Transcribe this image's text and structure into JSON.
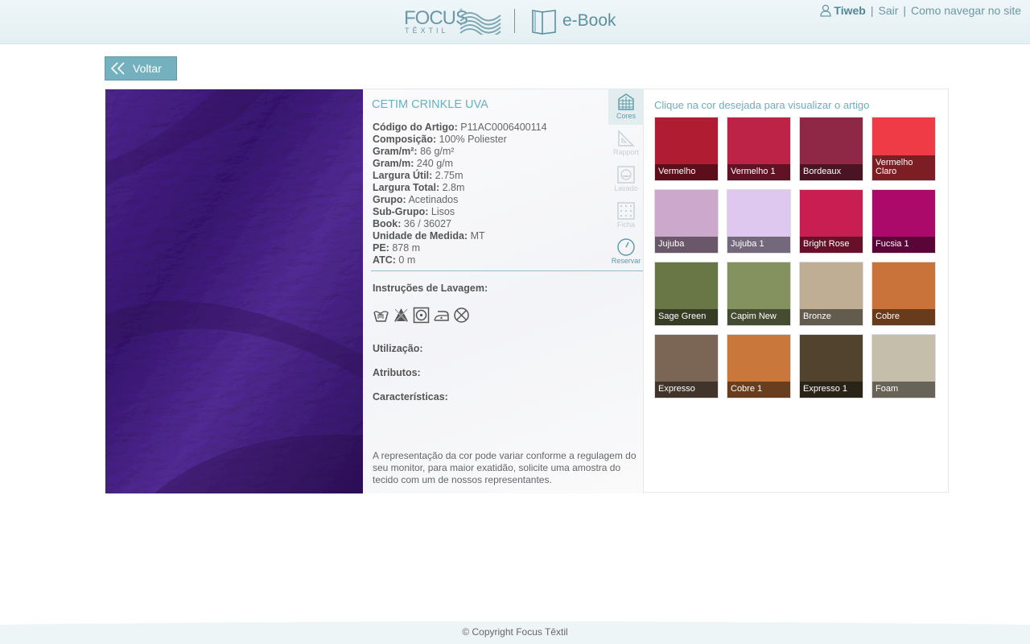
{
  "header": {
    "brand": "FOCUS",
    "brand_sub": "TÊXTIL",
    "section": "e-Book",
    "user": "Tiweb",
    "logout": "Sair",
    "help": "Como navegar no site"
  },
  "back_label": "Voltar",
  "product": {
    "title": "CETIM CRINKLE UVA",
    "specs": [
      {
        "label": "Código do Artigo:",
        "value": "P11AC0006400114"
      },
      {
        "label": "Composição:",
        "value": "100% Poliester"
      },
      {
        "label": "Gram/m²:",
        "value": "86 g/m²"
      },
      {
        "label": "Gram/m:",
        "value": "240 g/m"
      },
      {
        "label": "Largura Útil:",
        "value": "2.75m"
      },
      {
        "label": "Largura Total:",
        "value": "2.8m"
      },
      {
        "label": "Grupo:",
        "value": "Acetinados"
      },
      {
        "label": "Sub-Grupo:",
        "value": "Lisos"
      },
      {
        "label": "Book:",
        "value": "36 / 36027"
      },
      {
        "label": "Unidade de Medida:",
        "value": "MT"
      },
      {
        "label": "PE:",
        "value": "878 m"
      },
      {
        "label": "ATC:",
        "value": "0 m"
      }
    ],
    "wash_title": "Instruções de Lavagem:",
    "wash_icons": [
      "hand-wash-icon",
      "no-bleach-icon",
      "tumble-dry-icon",
      "iron-icon",
      "no-dry-clean-icon"
    ],
    "utilizacao": "Utilização:",
    "atributos": "Atributos:",
    "caracteristicas": "Características:",
    "disclaimer": "A representação da cor pode variar conforme a regulagem do seu monitor, para maior exatidão, solicite uma amostra do tecido com um de nossos representantes."
  },
  "tools": {
    "cores": "Cores",
    "rapport": "Rapport",
    "lavado": "Lavado",
    "ficha": "Ficha",
    "reservar": "Reservar"
  },
  "colors_title": "Clique na cor desejada para visualizar o artigo",
  "swatches": [
    {
      "name": "Vermelho",
      "color": "#b01d33"
    },
    {
      "name": "Vermelho 1",
      "color": "#bd2347"
    },
    {
      "name": "Bordeaux",
      "color": "#8f2846"
    },
    {
      "name": "Vermelho Claro",
      "color": "#ee3b45"
    },
    {
      "name": "Jujuba",
      "color": "#cba8cc"
    },
    {
      "name": "Jujuba 1",
      "color": "#dfc8ef"
    },
    {
      "name": "Bright Rose",
      "color": "#c81e52"
    },
    {
      "name": "Fucsia 1",
      "color": "#ab0a6a"
    },
    {
      "name": "Sage Green",
      "color": "#697646"
    },
    {
      "name": "Capim New",
      "color": "#84925f"
    },
    {
      "name": "Bronze",
      "color": "#bfae94"
    },
    {
      "name": "Cobre",
      "color": "#c97239"
    },
    {
      "name": "Expresso",
      "color": "#7b6554"
    },
    {
      "name": "Cobre 1",
      "color": "#c9773b"
    },
    {
      "name": "Expresso 1",
      "color": "#52432f"
    },
    {
      "name": "Foam",
      "color": "#c5beaa"
    }
  ],
  "footer": "© Copyright Focus Têxtil"
}
